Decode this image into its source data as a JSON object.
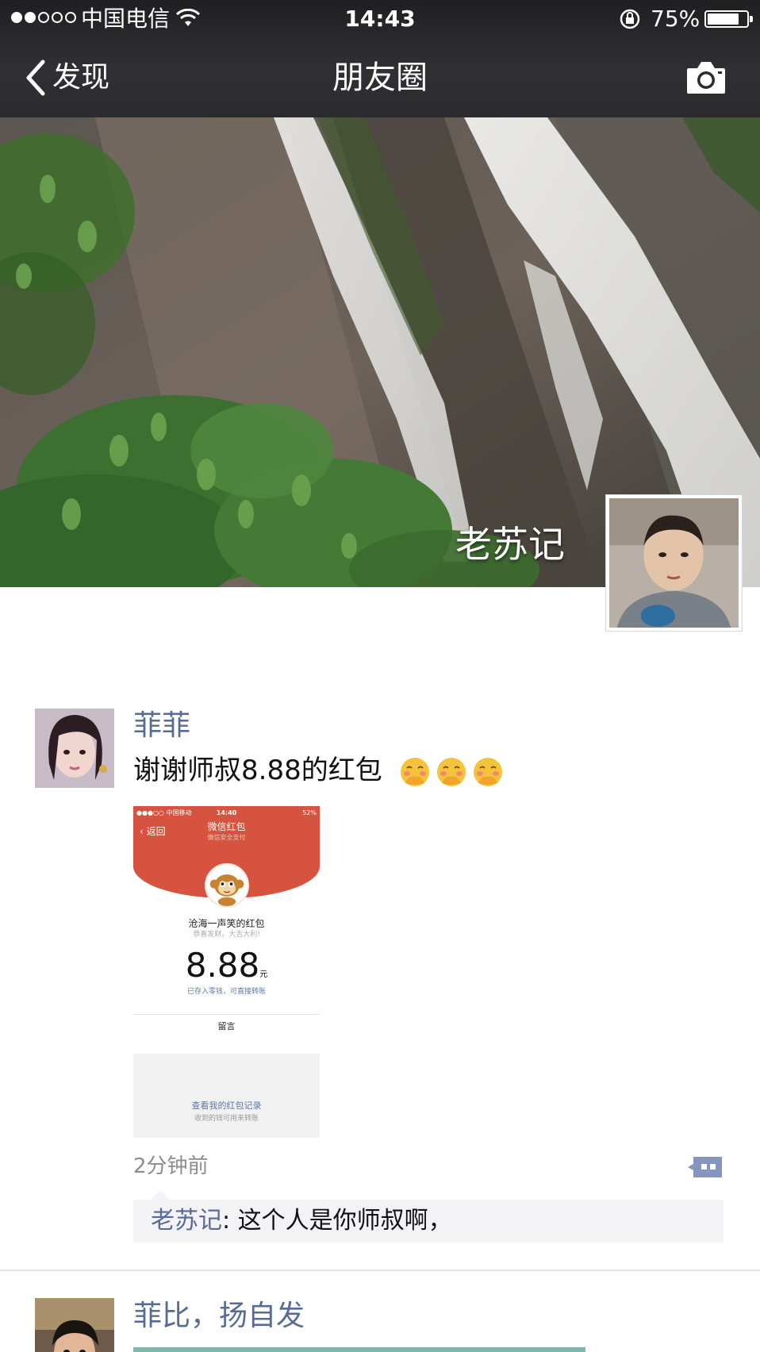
{
  "status_bar": {
    "carrier": "中国电信",
    "time": "14:43",
    "battery": "75%",
    "battery_level": 0.75,
    "signal_bars_filled": 2,
    "signal_bars_total": 5
  },
  "nav": {
    "back_label": "发现",
    "title": "朋友圈",
    "camera_icon": "camera-icon"
  },
  "cover": {
    "user_name": "老苏记"
  },
  "posts": [
    {
      "name": "菲菲",
      "text": "谢谢师叔8.88的红包",
      "emoji_icon": "covering-mouth-emoji",
      "emoji_count": 3,
      "image": {
        "status_carrier": "●●●○○ 中国移动",
        "status_time": "14:40",
        "status_battery": "52%",
        "back_label": "返回",
        "title": "微信红包",
        "subtitle": "微信安全支付",
        "sender": "沧海一声笑的红包",
        "wish": "恭喜发财，大吉大利!",
        "amount": "8.88",
        "unit": "元",
        "note": "已存入零钱，可直接转账",
        "message": "留言",
        "record_link": "查看我的红包记录",
        "record_hint": "收到的钱可用来转账"
      },
      "time": "2分钟前",
      "comment_icon": "comment-icon",
      "comments": [
        {
          "author": "老苏记",
          "separator": ": ",
          "text": "这个人是你师叔啊，"
        }
      ]
    },
    {
      "name": "菲比，扬自发"
    }
  ],
  "colors": {
    "link_blue": "#576b95",
    "nav_bg": "#2b2b2e",
    "envelope_red": "#d6533f"
  }
}
